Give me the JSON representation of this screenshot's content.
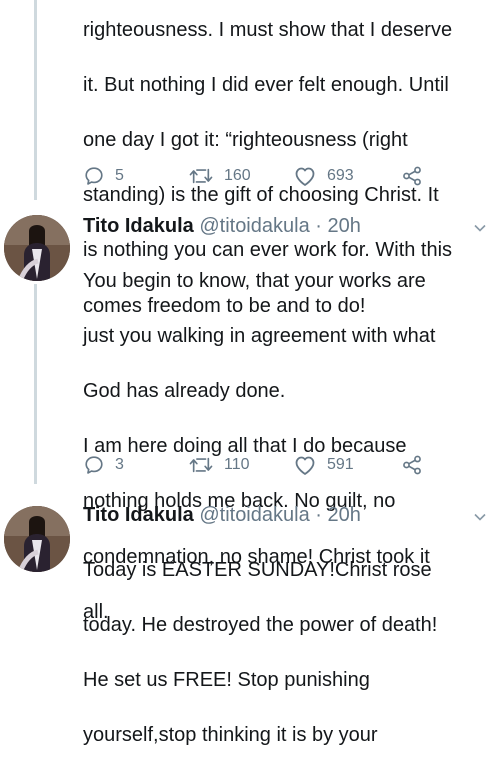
{
  "tweets": [
    {
      "text_lines": [
        "righteousness. I must show that I deserve",
        "it. But nothing I did ever felt enough. Until",
        "one day I got it: “righteousness (right",
        "standing) is the gift of choosing Christ. It",
        "is nothing you can ever work for. With this",
        "comes freedom to be and to do!"
      ],
      "replies": "5",
      "retweets": "160",
      "likes": "693"
    },
    {
      "author": "Tito Idakula",
      "handle": "@titoidakula",
      "separator": "·",
      "time": "20h",
      "text_lines": [
        "You begin to know, that your works are",
        "just you walking in agreement with what",
        "God has already done.",
        "I am here doing all that I do because",
        "nothing holds me back. No guilt, no",
        "condemnation, no shame! Christ took it",
        "all."
      ],
      "replies": "3",
      "retweets": "110",
      "likes": "591"
    },
    {
      "author": "Tito Idakula",
      "handle": "@titoidakula",
      "separator": "·",
      "time": "20h",
      "text_lines": [
        "Today is EASTER SUNDAY!Christ rose",
        "today. He destroyed the power of death!",
        "He set us FREE! Stop punishing",
        "yourself,stop thinking it is by your"
      ]
    }
  ],
  "icons": {
    "reply": "reply-icon",
    "retweet": "retweet-icon",
    "like": "heart-icon",
    "share": "share-icon",
    "caret": "chevron-down-icon"
  },
  "colors": {
    "text": "#14171a",
    "muted": "#657786",
    "thread_line": "#cfd9de"
  }
}
